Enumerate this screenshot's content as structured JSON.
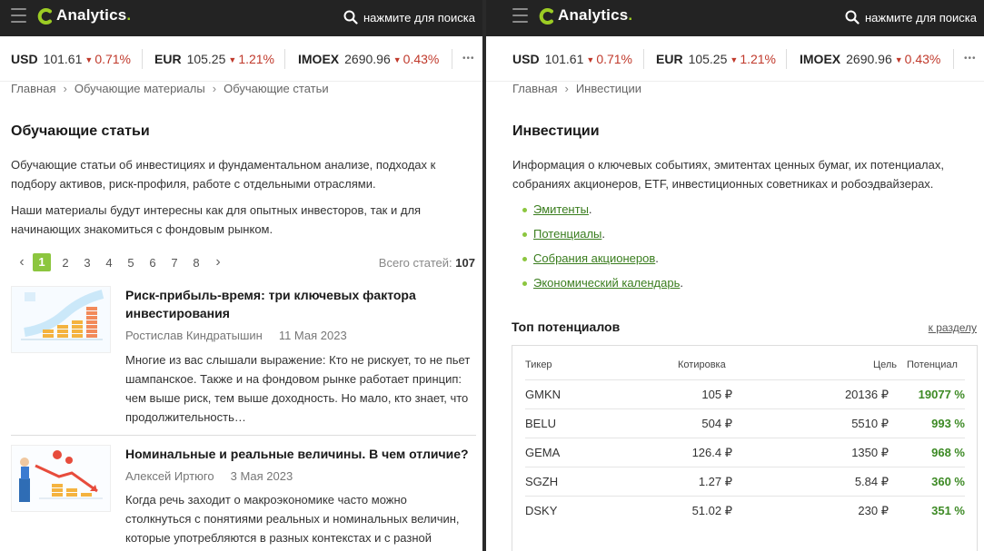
{
  "header": {
    "logo_text": "Analytics",
    "logo_dot": ".",
    "search_placeholder": "нажмите для поиска"
  },
  "ticker": [
    {
      "symbol": "USD",
      "value": "101.61",
      "change": "0.71%",
      "direction": "down"
    },
    {
      "symbol": "EUR",
      "value": "105.25",
      "change": "1.21%",
      "direction": "down"
    },
    {
      "symbol": "IMOEX",
      "value": "2690.96",
      "change": "0.43%",
      "direction": "down"
    }
  ],
  "ticker_more": "•••",
  "colors": {
    "accent": "#8cc63f",
    "negative": "#c0392b",
    "positive": "#3d8a25",
    "header_bg": "#232323"
  },
  "left": {
    "breadcrumbs": [
      "Главная",
      "Обучающие материалы",
      "Обучающие статьи"
    ],
    "title": "Обучающие статьи",
    "paragraphs": [
      "Обучающие статьи об инвестициях и фундаментальном анализе, подходах к подбору активов, риск-профиля, работе с отдельными отраслями.",
      "Наши материалы будут интересны как для опытных инвесторов, так и для начинающих знакомиться с фондовым рынком."
    ],
    "pager": {
      "pages": [
        "1",
        "2",
        "3",
        "4",
        "5",
        "6",
        "7",
        "8"
      ],
      "current": "1"
    },
    "total_label": "Всего статей:",
    "total_value": "107",
    "articles": [
      {
        "title": "Риск-прибыль-время: три ключевых фактора инвестирования",
        "author": "Ростислав Киндратышин",
        "date": "11 Мая 2023",
        "excerpt": "Многие из вас слышали выражение: Кто не рискует, то не пьет шампанское. Также и на фондовом рынке работает принцип: чем выше риск, тем выше доходность. Но мало, кто знает, что продолжительность…"
      },
      {
        "title": "Номинальные и реальные величины. В чем отличие?",
        "author": "Алексей Иртюго",
        "date": "3 Мая 2023",
        "excerpt": "Когда речь заходит о макроэкономике часто можно столкнуться с понятиями реальных и номинальных величин, которые употребляются в разных контекстах и с разной"
      }
    ]
  },
  "right": {
    "breadcrumbs": [
      "Главная",
      "Инвестиции"
    ],
    "title": "Инвестиции",
    "intro": "Информация о ключевых событиях, эмитентах ценных бумаг, их потенциалах, собраниях акционеров, ETF, инвестиционных советниках и робоэдвайзерах.",
    "links": [
      "Эмитенты",
      "Потенциалы",
      "Собрания акционеров",
      "Экономический календарь"
    ],
    "section_title": "Топ потенциалов",
    "section_link": "к разделу",
    "table": {
      "headers": {
        "ticker": "Тикер",
        "quote": "Котировка",
        "target": "Цель",
        "potential": "Потенциал"
      },
      "rows": [
        {
          "ticker": "GMKN",
          "quote": "105 ₽",
          "target": "20136 ₽",
          "potential": "19077 %"
        },
        {
          "ticker": "BELU",
          "quote": "504 ₽",
          "target": "5510 ₽",
          "potential": "993 %"
        },
        {
          "ticker": "GEMA",
          "quote": "126.4 ₽",
          "target": "1350 ₽",
          "potential": "968 %"
        },
        {
          "ticker": "SGZH",
          "quote": "1.27 ₽",
          "target": "5.84 ₽",
          "potential": "360 %"
        },
        {
          "ticker": "DSKY",
          "quote": "51.02 ₽",
          "target": "230 ₽",
          "potential": "351 %"
        }
      ]
    }
  }
}
